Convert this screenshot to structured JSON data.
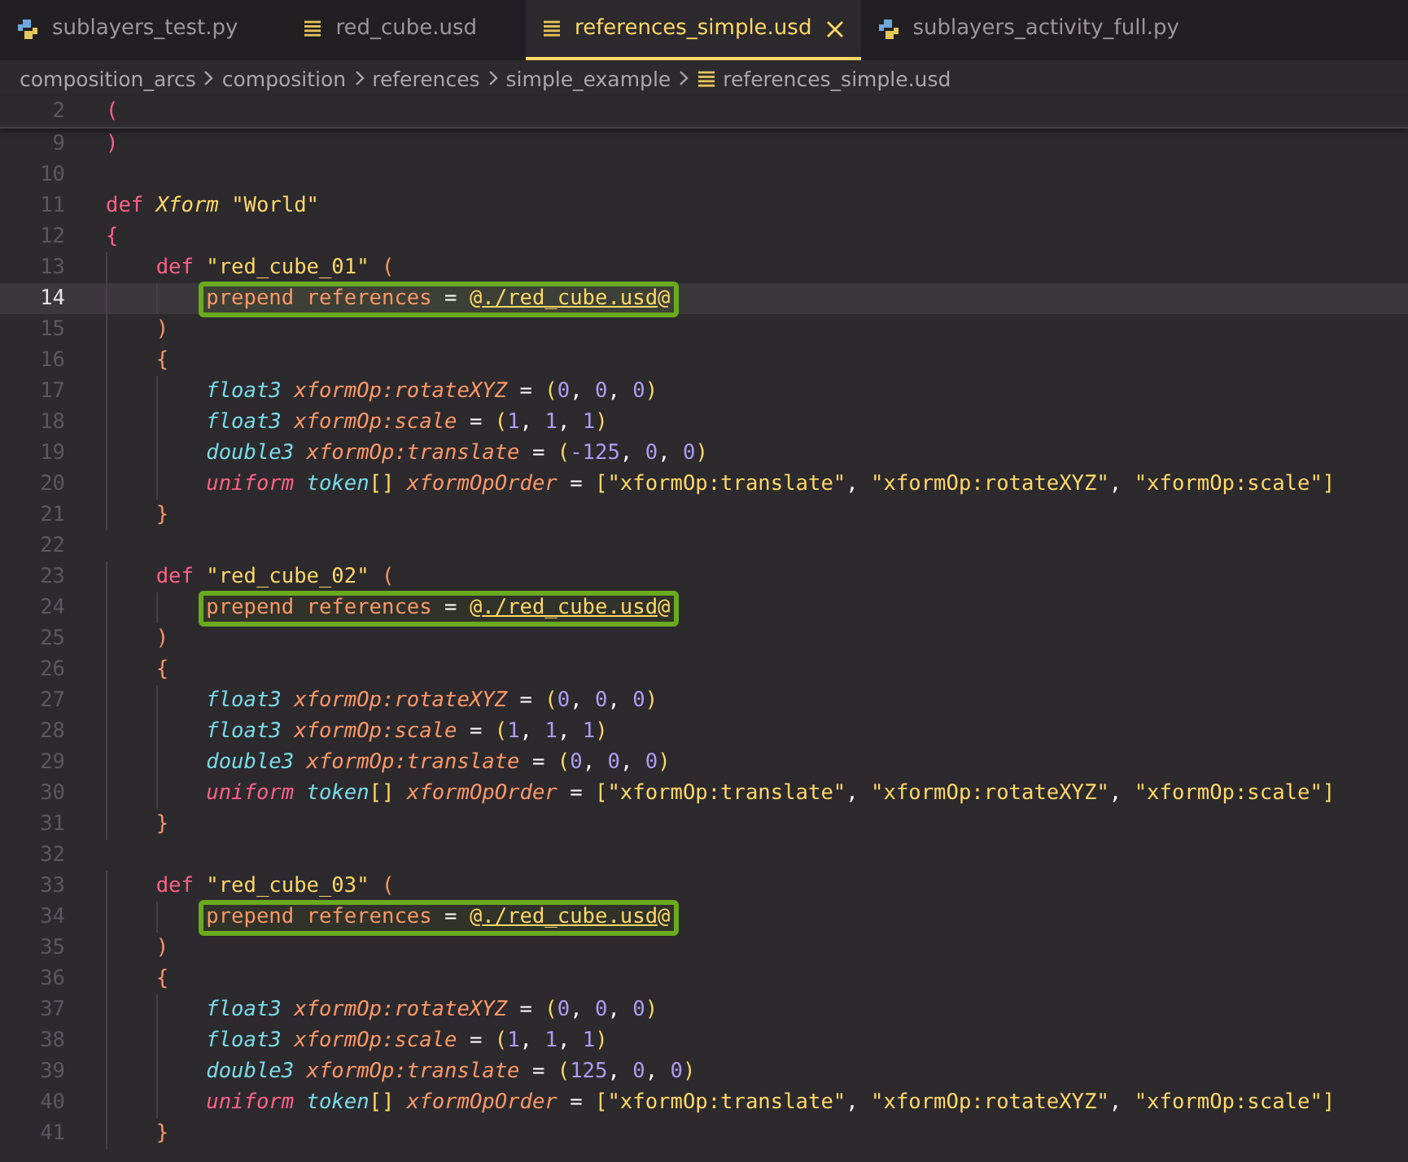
{
  "tabs": [
    {
      "label": "sublayers_test.py",
      "kind": "python",
      "selected": false
    },
    {
      "label": "red_cube.usd",
      "kind": "usd",
      "selected": false
    },
    {
      "label": "references_simple.usd",
      "kind": "usd",
      "selected": true
    },
    {
      "label": "sublayers_activity_full.py",
      "kind": "python",
      "selected": false
    }
  ],
  "breadcrumbs": [
    {
      "label": "composition_arcs",
      "kind": "folder"
    },
    {
      "label": "composition",
      "kind": "folder"
    },
    {
      "label": "references",
      "kind": "folder"
    },
    {
      "label": "simple_example",
      "kind": "folder"
    },
    {
      "label": "references_simple.usd",
      "kind": "usd"
    }
  ],
  "lines": [
    {
      "number": "2",
      "sticky": true,
      "current": false,
      "boxed": false,
      "tokens": [
        {
          "text": "(",
          "kind": "paren"
        }
      ]
    },
    {
      "number": "9",
      "sticky": false,
      "current": false,
      "boxed": false,
      "tokens": [
        {
          "text": ")",
          "kind": "paren"
        }
      ]
    },
    {
      "number": "10",
      "sticky": false,
      "current": false,
      "boxed": false
    },
    {
      "number": "11",
      "sticky": false,
      "current": false,
      "boxed": false,
      "tokens": [
        {
          "text": "def ",
          "kind": "keyword"
        },
        {
          "text": "Xform ",
          "kind": "class"
        },
        {
          "text": "\"World\"",
          "kind": "string"
        }
      ]
    },
    {
      "number": "12",
      "sticky": false,
      "current": false,
      "boxed": false,
      "tokens": [
        {
          "text": "{",
          "kind": "paren"
        }
      ]
    },
    {
      "number": "13",
      "sticky": false,
      "current": false,
      "boxed": false,
      "tokens": [
        {
          "text": "    def ",
          "kind": "keyword"
        },
        {
          "text": "\"red_cube_01\" ",
          "kind": "string"
        },
        {
          "text": "(",
          "kind": "brace"
        }
      ]
    },
    {
      "number": "14",
      "sticky": false,
      "current": true,
      "boxed": true,
      "tokens": [
        {
          "text": "        prepend references",
          "kind": "meta"
        },
        {
          "text": " = ",
          "kind": "plain"
        },
        {
          "text": "@",
          "kind": "at"
        },
        {
          "text": "./red_cube.usd",
          "kind": "asset"
        },
        {
          "text": "@",
          "kind": "at"
        }
      ]
    },
    {
      "number": "15",
      "sticky": false,
      "current": false,
      "boxed": false,
      "tokens": [
        {
          "text": "    )",
          "kind": "brace"
        }
      ]
    },
    {
      "number": "16",
      "sticky": false,
      "current": false,
      "boxed": false,
      "tokens": [
        {
          "text": "    {",
          "kind": "brace"
        }
      ]
    },
    {
      "number": "17",
      "sticky": false,
      "current": false,
      "boxed": false,
      "tokens": [
        {
          "text": "        float3 ",
          "kind": "type"
        },
        {
          "text": "xformOp:rotateXYZ",
          "kind": "attr"
        },
        {
          "text": " = ",
          "kind": "plain"
        },
        {
          "text": "(",
          "kind": "bracket"
        },
        {
          "text": "0",
          "kind": "number"
        },
        {
          "text": ", ",
          "kind": "plain"
        },
        {
          "text": "0",
          "kind": "number"
        },
        {
          "text": ", ",
          "kind": "plain"
        },
        {
          "text": "0",
          "kind": "number"
        },
        {
          "text": ")",
          "kind": "bracket"
        }
      ]
    },
    {
      "number": "18",
      "sticky": false,
      "current": false,
      "boxed": false,
      "tokens": [
        {
          "text": "        float3 ",
          "kind": "type"
        },
        {
          "text": "xformOp:scale",
          "kind": "attr"
        },
        {
          "text": " = ",
          "kind": "plain"
        },
        {
          "text": "(",
          "kind": "bracket"
        },
        {
          "text": "1",
          "kind": "number"
        },
        {
          "text": ", ",
          "kind": "plain"
        },
        {
          "text": "1",
          "kind": "number"
        },
        {
          "text": ", ",
          "kind": "plain"
        },
        {
          "text": "1",
          "kind": "number"
        },
        {
          "text": ")",
          "kind": "bracket"
        }
      ]
    },
    {
      "number": "19",
      "sticky": false,
      "current": false,
      "boxed": false,
      "tokens": [
        {
          "text": "        double3 ",
          "kind": "type"
        },
        {
          "text": "xformOp:translate",
          "kind": "attr"
        },
        {
          "text": " = ",
          "kind": "plain"
        },
        {
          "text": "(",
          "kind": "bracket"
        },
        {
          "text": "-125",
          "kind": "number"
        },
        {
          "text": ", ",
          "kind": "plain"
        },
        {
          "text": "0",
          "kind": "number"
        },
        {
          "text": ", ",
          "kind": "plain"
        },
        {
          "text": "0",
          "kind": "number"
        },
        {
          "text": ")",
          "kind": "bracket"
        }
      ]
    },
    {
      "number": "20",
      "sticky": false,
      "current": false,
      "boxed": false,
      "tokens": [
        {
          "text": "        uniform ",
          "kind": "storage"
        },
        {
          "text": "token",
          "kind": "type"
        },
        {
          "text": "[] ",
          "kind": "bracket"
        },
        {
          "text": "xformOpOrder",
          "kind": "attr"
        },
        {
          "text": " = ",
          "kind": "plain"
        },
        {
          "text": "[",
          "kind": "bracket"
        },
        {
          "text": "\"xformOp:translate\"",
          "kind": "string"
        },
        {
          "text": ", ",
          "kind": "plain"
        },
        {
          "text": "\"xformOp:rotateXYZ\"",
          "kind": "string"
        },
        {
          "text": ", ",
          "kind": "plain"
        },
        {
          "text": "\"xformOp:scale\"",
          "kind": "string"
        },
        {
          "text": "]",
          "kind": "bracket"
        }
      ]
    },
    {
      "number": "21",
      "sticky": false,
      "current": false,
      "boxed": false,
      "tokens": [
        {
          "text": "    }",
          "kind": "brace"
        }
      ]
    },
    {
      "number": "22",
      "sticky": false,
      "current": false,
      "boxed": false
    },
    {
      "number": "23",
      "sticky": false,
      "current": false,
      "boxed": false,
      "tokens": [
        {
          "text": "    def ",
          "kind": "keyword"
        },
        {
          "text": "\"red_cube_02\" ",
          "kind": "string"
        },
        {
          "text": "(",
          "kind": "brace"
        }
      ]
    },
    {
      "number": "24",
      "sticky": false,
      "current": false,
      "boxed": true,
      "tokens": [
        {
          "text": "        prepend references",
          "kind": "meta"
        },
        {
          "text": " = ",
          "kind": "plain"
        },
        {
          "text": "@",
          "kind": "at"
        },
        {
          "text": "./red_cube.usd",
          "kind": "asset"
        },
        {
          "text": "@",
          "kind": "at"
        }
      ]
    },
    {
      "number": "25",
      "sticky": false,
      "current": false,
      "boxed": false,
      "tokens": [
        {
          "text": "    )",
          "kind": "brace"
        }
      ]
    },
    {
      "number": "26",
      "sticky": false,
      "current": false,
      "boxed": false,
      "tokens": [
        {
          "text": "    {",
          "kind": "brace"
        }
      ]
    },
    {
      "number": "27",
      "sticky": false,
      "current": false,
      "boxed": false,
      "tokens": [
        {
          "text": "        float3 ",
          "kind": "type"
        },
        {
          "text": "xformOp:rotateXYZ",
          "kind": "attr"
        },
        {
          "text": " = ",
          "kind": "plain"
        },
        {
          "text": "(",
          "kind": "bracket"
        },
        {
          "text": "0",
          "kind": "number"
        },
        {
          "text": ", ",
          "kind": "plain"
        },
        {
          "text": "0",
          "kind": "number"
        },
        {
          "text": ", ",
          "kind": "plain"
        },
        {
          "text": "0",
          "kind": "number"
        },
        {
          "text": ")",
          "kind": "bracket"
        }
      ]
    },
    {
      "number": "28",
      "sticky": false,
      "current": false,
      "boxed": false,
      "tokens": [
        {
          "text": "        float3 ",
          "kind": "type"
        },
        {
          "text": "xformOp:scale",
          "kind": "attr"
        },
        {
          "text": " = ",
          "kind": "plain"
        },
        {
          "text": "(",
          "kind": "bracket"
        },
        {
          "text": "1",
          "kind": "number"
        },
        {
          "text": ", ",
          "kind": "plain"
        },
        {
          "text": "1",
          "kind": "number"
        },
        {
          "text": ", ",
          "kind": "plain"
        },
        {
          "text": "1",
          "kind": "number"
        },
        {
          "text": ")",
          "kind": "bracket"
        }
      ]
    },
    {
      "number": "29",
      "sticky": false,
      "current": false,
      "boxed": false,
      "tokens": [
        {
          "text": "        double3 ",
          "kind": "type"
        },
        {
          "text": "xformOp:translate",
          "kind": "attr"
        },
        {
          "text": " = ",
          "kind": "plain"
        },
        {
          "text": "(",
          "kind": "bracket"
        },
        {
          "text": "0",
          "kind": "number"
        },
        {
          "text": ", ",
          "kind": "plain"
        },
        {
          "text": "0",
          "kind": "number"
        },
        {
          "text": ", ",
          "kind": "plain"
        },
        {
          "text": "0",
          "kind": "number"
        },
        {
          "text": ")",
          "kind": "bracket"
        }
      ]
    },
    {
      "number": "30",
      "sticky": false,
      "current": false,
      "boxed": false,
      "tokens": [
        {
          "text": "        uniform ",
          "kind": "storage"
        },
        {
          "text": "token",
          "kind": "type"
        },
        {
          "text": "[] ",
          "kind": "bracket"
        },
        {
          "text": "xformOpOrder",
          "kind": "attr"
        },
        {
          "text": " = ",
          "kind": "plain"
        },
        {
          "text": "[",
          "kind": "bracket"
        },
        {
          "text": "\"xformOp:translate\"",
          "kind": "string"
        },
        {
          "text": ", ",
          "kind": "plain"
        },
        {
          "text": "\"xformOp:rotateXYZ\"",
          "kind": "string"
        },
        {
          "text": ", ",
          "kind": "plain"
        },
        {
          "text": "\"xformOp:scale\"",
          "kind": "string"
        },
        {
          "text": "]",
          "kind": "bracket"
        }
      ]
    },
    {
      "number": "31",
      "sticky": false,
      "current": false,
      "boxed": false,
      "tokens": [
        {
          "text": "    }",
          "kind": "brace"
        }
      ]
    },
    {
      "number": "32",
      "sticky": false,
      "current": false,
      "boxed": false
    },
    {
      "number": "33",
      "sticky": false,
      "current": false,
      "boxed": false,
      "tokens": [
        {
          "text": "    def ",
          "kind": "keyword"
        },
        {
          "text": "\"red_cube_03\" ",
          "kind": "string"
        },
        {
          "text": "(",
          "kind": "brace"
        }
      ]
    },
    {
      "number": "34",
      "sticky": false,
      "current": false,
      "boxed": true,
      "tokens": [
        {
          "text": "        prepend references",
          "kind": "meta"
        },
        {
          "text": " = ",
          "kind": "plain"
        },
        {
          "text": "@",
          "kind": "at"
        },
        {
          "text": "./red_cube.usd",
          "kind": "asset"
        },
        {
          "text": "@",
          "kind": "at"
        }
      ]
    },
    {
      "number": "35",
      "sticky": false,
      "current": false,
      "boxed": false,
      "tokens": [
        {
          "text": "    )",
          "kind": "brace"
        }
      ]
    },
    {
      "number": "36",
      "sticky": false,
      "current": false,
      "boxed": false,
      "tokens": [
        {
          "text": "    {",
          "kind": "brace"
        }
      ]
    },
    {
      "number": "37",
      "sticky": false,
      "current": false,
      "boxed": false,
      "tokens": [
        {
          "text": "        float3 ",
          "kind": "type"
        },
        {
          "text": "xformOp:rotateXYZ",
          "kind": "attr"
        },
        {
          "text": " = ",
          "kind": "plain"
        },
        {
          "text": "(",
          "kind": "bracket"
        },
        {
          "text": "0",
          "kind": "number"
        },
        {
          "text": ", ",
          "kind": "plain"
        },
        {
          "text": "0",
          "kind": "number"
        },
        {
          "text": ", ",
          "kind": "plain"
        },
        {
          "text": "0",
          "kind": "number"
        },
        {
          "text": ")",
          "kind": "bracket"
        }
      ]
    },
    {
      "number": "38",
      "sticky": false,
      "current": false,
      "boxed": false,
      "tokens": [
        {
          "text": "        float3 ",
          "kind": "type"
        },
        {
          "text": "xformOp:scale",
          "kind": "attr"
        },
        {
          "text": " = ",
          "kind": "plain"
        },
        {
          "text": "(",
          "kind": "bracket"
        },
        {
          "text": "1",
          "kind": "number"
        },
        {
          "text": ", ",
          "kind": "plain"
        },
        {
          "text": "1",
          "kind": "number"
        },
        {
          "text": ", ",
          "kind": "plain"
        },
        {
          "text": "1",
          "kind": "number"
        },
        {
          "text": ")",
          "kind": "bracket"
        }
      ]
    },
    {
      "number": "39",
      "sticky": false,
      "current": false,
      "boxed": false,
      "tokens": [
        {
          "text": "        double3 ",
          "kind": "type"
        },
        {
          "text": "xformOp:translate",
          "kind": "attr"
        },
        {
          "text": " = ",
          "kind": "plain"
        },
        {
          "text": "(",
          "kind": "bracket"
        },
        {
          "text": "125",
          "kind": "number"
        },
        {
          "text": ", ",
          "kind": "plain"
        },
        {
          "text": "0",
          "kind": "number"
        },
        {
          "text": ", ",
          "kind": "plain"
        },
        {
          "text": "0",
          "kind": "number"
        },
        {
          "text": ")",
          "kind": "bracket"
        }
      ]
    },
    {
      "number": "40",
      "sticky": false,
      "current": false,
      "boxed": false,
      "tokens": [
        {
          "text": "        uniform ",
          "kind": "storage"
        },
        {
          "text": "token",
          "kind": "type"
        },
        {
          "text": "[] ",
          "kind": "bracket"
        },
        {
          "text": "xformOpOrder",
          "kind": "attr"
        },
        {
          "text": " = ",
          "kind": "plain"
        },
        {
          "text": "[",
          "kind": "bracket"
        },
        {
          "text": "\"xformOp:translate\"",
          "kind": "string"
        },
        {
          "text": ", ",
          "kind": "plain"
        },
        {
          "text": "\"xformOp:rotateXYZ\"",
          "kind": "string"
        },
        {
          "text": ", ",
          "kind": "plain"
        },
        {
          "text": "\"xformOp:scale\"",
          "kind": "string"
        },
        {
          "text": "]",
          "kind": "bracket"
        }
      ]
    },
    {
      "number": "41",
      "sticky": false,
      "current": false,
      "boxed": false,
      "tokens": [
        {
          "text": "    }",
          "kind": "brace"
        }
      ]
    }
  ]
}
